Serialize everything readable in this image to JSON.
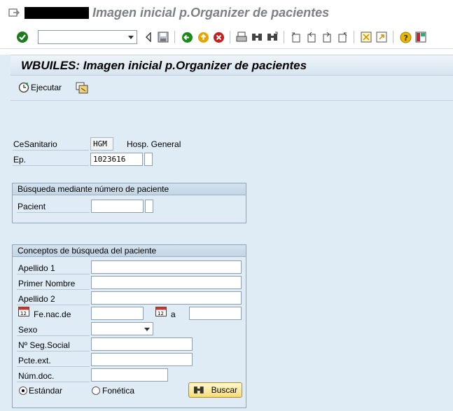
{
  "window": {
    "title": "Imagen inicial p.Organizer de pacientes"
  },
  "toolbar": {
    "command_field": "",
    "buttons": [
      "enter-icon",
      "back-nav-icon",
      "save-icon",
      "back-icon",
      "exit-icon",
      "cancel-icon",
      "print-icon",
      "find-icon",
      "find-next-icon",
      "first-page-icon",
      "prev-page-icon",
      "next-page-icon",
      "last-page-icon",
      "new-session-icon",
      "shortcut-icon",
      "help-icon",
      "layout-icon"
    ]
  },
  "screen": {
    "title": "WBUILES: Imagen inicial p.Organizer de pacientes",
    "execute_label": "Ejecutar"
  },
  "form": {
    "cesanitario_label": "CeSanitario",
    "cesanitario_value": "HGM",
    "cesanitario_text": "Hosp. General",
    "ep_label": "Ep.",
    "ep_value": "1023616"
  },
  "group_patient_number": {
    "title": "Búsqueda mediante número de paciente",
    "pacient_label": "Pacient",
    "pacient_value": ""
  },
  "group_search": {
    "title": "Conceptos de búsqueda del paciente",
    "apellido1_label": "Apellido 1",
    "apellido1_value": "",
    "primer_nombre_label": "Primer Nombre",
    "primer_nombre_value": "",
    "apellido2_label": "Apellido 2",
    "apellido2_value": "",
    "fenac_label": "Fe.nac.de",
    "fenac_value": "",
    "a_label": "a",
    "a_value": "",
    "sexo_label": "Sexo",
    "sexo_value": "",
    "nss_label": "Nº Seg.Social",
    "nss_value": "",
    "pcte_ext_label": "Pcte.ext.",
    "pcte_ext_value": "",
    "num_doc_label": "Núm.doc.",
    "num_doc_value": "",
    "radio_estandar_label": "Estándar",
    "radio_fonetica_label": "Fonética",
    "radio_selected": "Estándar",
    "buscar_label": "Buscar"
  },
  "colors": {
    "background": "#dfebf5",
    "header_title_gray": "#7b8185",
    "button_yellow": "#f6dd7a"
  }
}
